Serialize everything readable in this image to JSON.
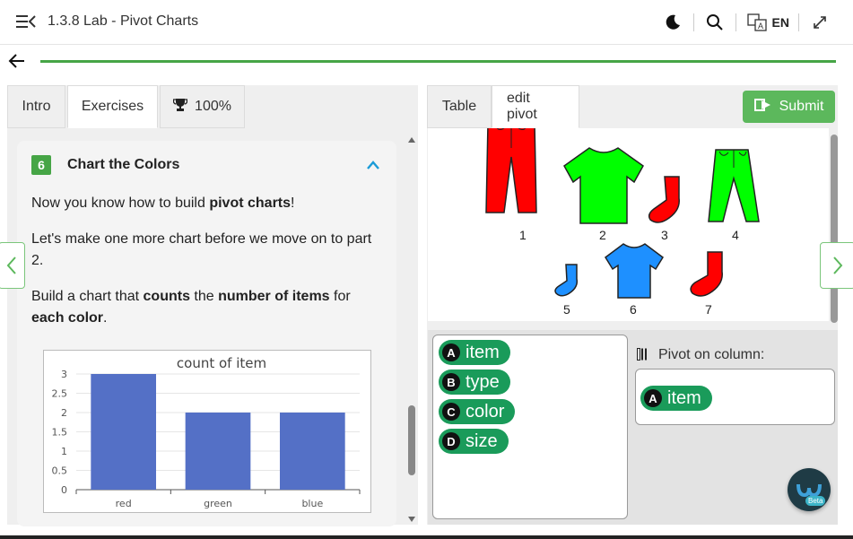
{
  "app": {
    "title": "1.3.8 Lab - Pivot Charts",
    "language": "EN",
    "progress_percent": 100
  },
  "left_tabs": [
    {
      "label": "Intro"
    },
    {
      "label": "Exercises"
    },
    {
      "label": "100%"
    }
  ],
  "card": {
    "step_number": "6",
    "title": "Chart the Colors",
    "p1_pre": "Now you know how to build ",
    "p1_bold": "pivot charts",
    "p1_post": "!",
    "p2": "Let's make one more chart before we move on to part 2.",
    "p3_a": "Build a chart that ",
    "p3_b": "counts",
    "p3_c": " the ",
    "p3_d": "number of items",
    "p3_e": " for ",
    "p3_f": "each color",
    "p3_g": "."
  },
  "chart_data": {
    "type": "bar",
    "title": "count of item",
    "categories": [
      "red",
      "green",
      "blue"
    ],
    "values": [
      3,
      2,
      2
    ],
    "ylim": [
      0,
      3
    ],
    "yticks": [
      "0",
      "0.5",
      "1",
      "1.5",
      "2",
      "2.5",
      "3"
    ],
    "grid": true,
    "bar_color": "#5470c6"
  },
  "right_tabs": [
    {
      "label": "Table"
    },
    {
      "label": "edit pivot"
    }
  ],
  "submit_label": "Submit",
  "items": [
    {
      "num": "1",
      "kind": "pants",
      "color": "#ff0000"
    },
    {
      "num": "2",
      "kind": "shirt",
      "color": "#00ff00"
    },
    {
      "num": "3",
      "kind": "sock",
      "color": "#ff0000"
    },
    {
      "num": "4",
      "kind": "pants",
      "color": "#00ff00"
    },
    {
      "num": "5",
      "kind": "sock",
      "color": "#1e90ff"
    },
    {
      "num": "6",
      "kind": "shirt",
      "color": "#1e90ff"
    },
    {
      "num": "7",
      "kind": "sock",
      "color": "#ff0000"
    }
  ],
  "fields": [
    {
      "letter": "A",
      "name": "item"
    },
    {
      "letter": "B",
      "name": "type"
    },
    {
      "letter": "C",
      "name": "color"
    },
    {
      "letter": "D",
      "name": "size"
    }
  ],
  "pivot": {
    "label": "Pivot on column:",
    "selected": {
      "letter": "A",
      "name": "item"
    }
  },
  "colors": {
    "accent_green": "#46a546",
    "chip_green": "#1a9b5a",
    "submit_green": "#5cb85c"
  }
}
